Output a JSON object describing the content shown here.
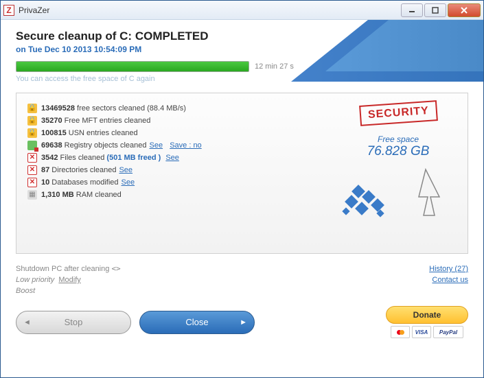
{
  "window": {
    "title": "PrivaZer"
  },
  "header": {
    "title": "Secure cleanup of C: COMPLETED",
    "subtitle": "on Tue  Dec 10  2013 10:54:09 PM",
    "elapsed": "12 min 27 s",
    "access_msg": "You can access the free space of C again"
  },
  "results": [
    {
      "icon": "lock",
      "num": "13469528",
      "text": " free sectors cleaned (88.4 MB/s)"
    },
    {
      "icon": "lock",
      "num": "35270",
      "text": " Free MFT entries cleaned"
    },
    {
      "icon": "lock",
      "num": "100815",
      "text": " USN entries cleaned"
    },
    {
      "icon": "reg",
      "num": "69638",
      "text": " Registry objects cleaned",
      "see": "See",
      "extra": "Save : no"
    },
    {
      "icon": "x",
      "num": "3542",
      "text": " Files cleaned ",
      "freed": "(501 MB freed )",
      "see": "See"
    },
    {
      "icon": "x",
      "num": "87",
      "text": " Directories cleaned",
      "see": "See"
    },
    {
      "icon": "x",
      "num": "10",
      "text": " Databases modified",
      "see": "See"
    },
    {
      "icon": "ram",
      "num": "1,310 MB",
      "text": " RAM cleaned"
    }
  ],
  "right": {
    "stamp": "SECURITY",
    "freespace_label": "Free space",
    "freespace_value": "76.828 GB"
  },
  "bottom": {
    "shutdown": "Shutdown PC after cleaning",
    "lowpriority": "Low priority",
    "modify": "Modify",
    "boost": "Boost",
    "history": "History (27)",
    "contact": "Contact us"
  },
  "buttons": {
    "stop": "Stop",
    "close": "Close",
    "donate": "Donate",
    "cards": {
      "visa": "VISA",
      "paypal": "PayPal"
    }
  }
}
